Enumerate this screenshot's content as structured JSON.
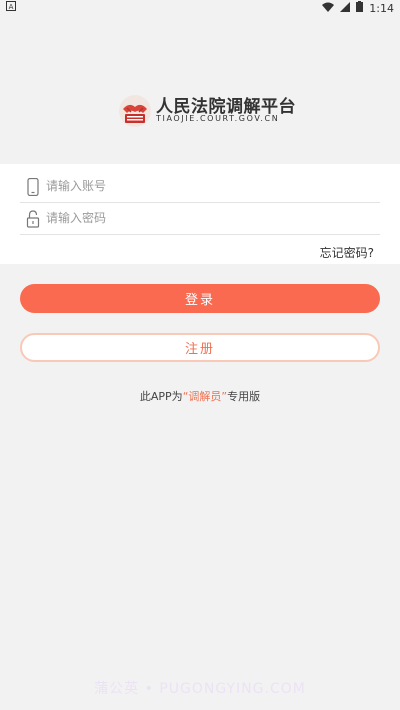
{
  "status_bar": {
    "left_icon": "a-icon",
    "wifi_icon": "wifi-icon",
    "signal_icon": "signal-icon",
    "battery_icon": "battery-icon",
    "time": "1:14"
  },
  "logo": {
    "title": "人民法院调解平台",
    "subtitle": "TIAOJIE.COURT.GOV.CN",
    "emblem_text": "人民法院调解平台"
  },
  "form": {
    "account_placeholder": "请输入账号",
    "password_placeholder": "请输入密码",
    "forgot_label": "忘记密码?"
  },
  "buttons": {
    "login_label": "登录",
    "register_label": "注册"
  },
  "note": {
    "prefix": "此APP为",
    "highlight": "“调解员”",
    "suffix": "专用版"
  },
  "watermark": "蒲公英 • PUGONGYING.COM",
  "colors": {
    "accent": "#f96a50",
    "register_border": "#f9c9b8",
    "background": "#f2f2f2"
  }
}
